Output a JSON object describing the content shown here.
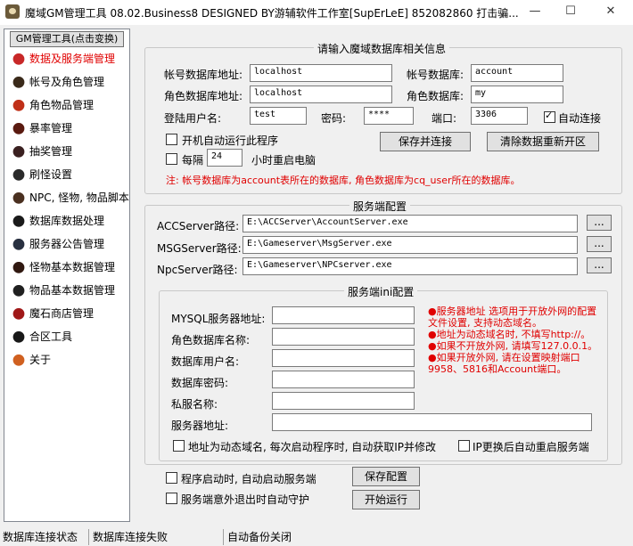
{
  "window": {
    "title": "魔域GM管理工具 08.02.Business8 DESIGNED BY游辅软件工作室[SupErLeE] 852082860  打击骗...",
    "minimize": "—",
    "maximize": "☐",
    "close": "✕"
  },
  "sidebar": {
    "header": "GM管理工具(点击变换)",
    "items": [
      {
        "label": "数据及服务端管理",
        "icon": "ribbon-icon",
        "color": "#c82828"
      },
      {
        "label": "帐号及角色管理",
        "icon": "character-icon",
        "color": "#3a2a1a"
      },
      {
        "label": "角色物品管理",
        "icon": "item-icon",
        "color": "#c03018"
      },
      {
        "label": "暴率管理",
        "icon": "monster-icon",
        "color": "#5a1a10"
      },
      {
        "label": "抽奖管理",
        "icon": "lottery-icon",
        "color": "#3a2020"
      },
      {
        "label": "刷怪设置",
        "icon": "spawn-icon",
        "color": "#2a2a2a"
      },
      {
        "label": "NPC, 怪物, 物品脚本",
        "icon": "script-icon",
        "color": "#4a3020"
      },
      {
        "label": "数据库数据处理",
        "icon": "database-icon",
        "color": "#1a1a1a"
      },
      {
        "label": "服务器公告管理",
        "icon": "announcement-icon",
        "color": "#283040"
      },
      {
        "label": "怪物基本数据管理",
        "icon": "monster-data-icon",
        "color": "#301810"
      },
      {
        "label": "物品基本数据管理",
        "icon": "item-data-icon",
        "color": "#202020"
      },
      {
        "label": "魔石商店管理",
        "icon": "shop-icon",
        "color": "#a01818"
      },
      {
        "label": "合区工具",
        "icon": "merge-icon",
        "color": "#181818"
      },
      {
        "label": "关于",
        "icon": "about-icon",
        "color": "#d06020"
      }
    ]
  },
  "db": {
    "group_title": "请输入魔域数据库相关信息",
    "account_addr_label": "帐号数据库地址:",
    "account_addr": "localhost",
    "account_db_label": "帐号数据库:",
    "account_db": "account",
    "role_addr_label": "角色数据库地址:",
    "role_addr": "localhost",
    "role_db_label": "角色数据库:",
    "role_db": "my",
    "user_label": "登陆用户名:",
    "user": "test",
    "password_label": "密码:",
    "password": "****",
    "port_label": "端口:",
    "port": "3306",
    "auto_connect_label": "自动连接",
    "auto_connect": true,
    "autorun_label": "开机自动运行此程序",
    "autorun": false,
    "every_label": "每隔",
    "every_hours": "24",
    "reboot_label": "小时重启电脑",
    "save_connect": "保存并连接",
    "clear_reset": "清除数据重新开区",
    "note": "注: 帐号数据库为account表所在的数据库, 角色数据库为cq_user所在的数据库。"
  },
  "server": {
    "group_title": "服务端配置",
    "acc_label": "ACCServer路径:",
    "acc_path": "E:\\ACCServer\\AccountServer.exe",
    "msg_label": "MSGServer路径:",
    "msg_path": "E:\\Gameserver\\MsgServer.exe",
    "npc_label": "NpcServer路径:",
    "npc_path": "E:\\Gameserver\\NPCserver.exe",
    "browse": "...",
    "ini": {
      "title": "服务端ini配置",
      "mysql_label": "MYSQL服务器地址:",
      "roledb_label": "角色数据库名称:",
      "dbuser_label": "数据库用户名:",
      "dbpass_label": "数据库密码:",
      "privname_label": "私服名称:",
      "srvaddr_label": "服务器地址:",
      "dynamic_label": "地址为动态域名, 每次启动程序时, 自动获取IP并修改",
      "ipchange_label": "IP更换后自动重启服务端",
      "tips": [
        "●服务器地址 选项用于开放外网的配置文件设置, 支持动态域名。",
        "●地址为动态域名时, 不填写http://。",
        "●如果不开放外网, 请填写127.0.0.1。",
        "●如果开放外网, 请在设置映射端口9958、5816和Account端口。"
      ]
    },
    "autostart_label": "程序启动时, 自动启动服务端",
    "guard_label": "服务端意外退出时自动守护",
    "save_config": "保存配置",
    "start_run": "开始运行"
  },
  "status": {
    "db_state_label": "数据库连接状态",
    "db_state_value": "数据库连接失败",
    "backup": "自动备份关闭"
  }
}
